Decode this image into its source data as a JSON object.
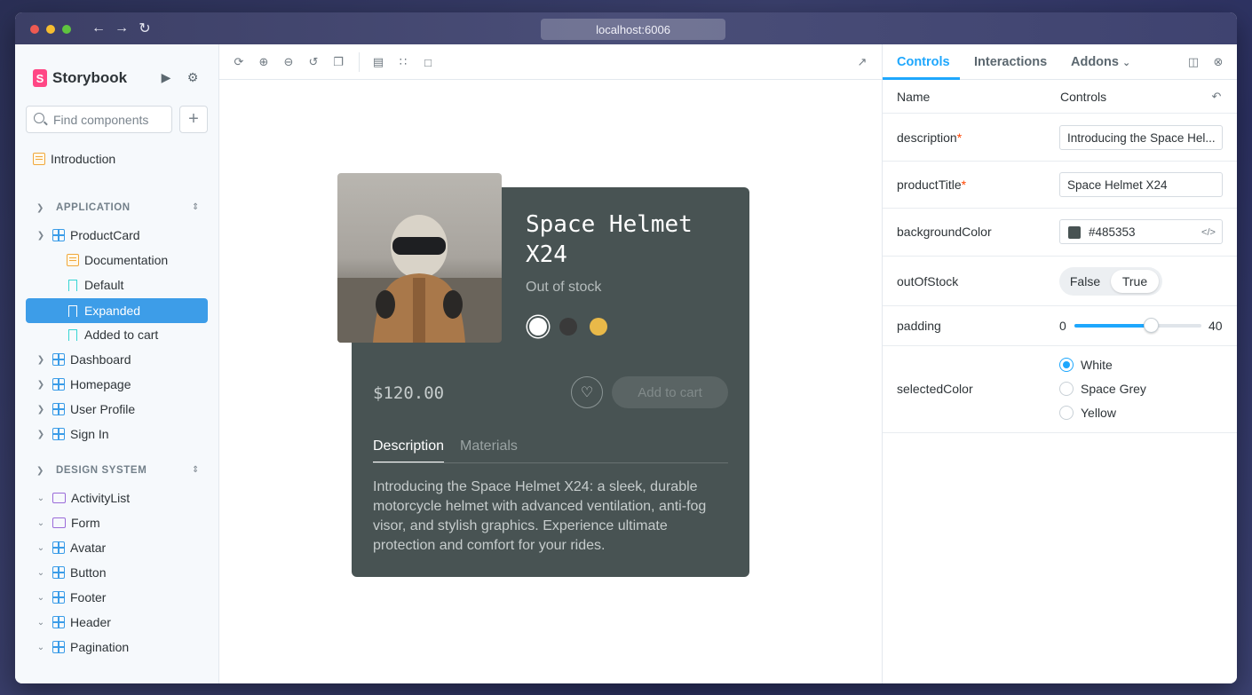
{
  "browser": {
    "url": "localhost:6006",
    "back_icon": "arrow-left-icon",
    "forward_icon": "arrow-right-icon",
    "reload_icon": "reload-icon"
  },
  "sidebar": {
    "brand": "Storybook",
    "search_placeholder": "Find components",
    "introduction": "Introduction",
    "sections": [
      {
        "label": "APPLICATION"
      },
      {
        "label": "DESIGN SYSTEM"
      }
    ],
    "app_items": [
      {
        "label": "ProductCard"
      },
      {
        "label": "Documentation"
      },
      {
        "label": "Default"
      },
      {
        "label": "Expanded"
      },
      {
        "label": "Added to cart"
      },
      {
        "label": "Dashboard"
      },
      {
        "label": "Homepage"
      },
      {
        "label": "User Profile"
      },
      {
        "label": "Sign In"
      }
    ],
    "ds_items": [
      {
        "label": "ActivityList"
      },
      {
        "label": "Form"
      },
      {
        "label": "Avatar"
      },
      {
        "label": "Button"
      },
      {
        "label": "Footer"
      },
      {
        "label": "Header"
      },
      {
        "label": "Pagination"
      }
    ],
    "selected": "Expanded"
  },
  "card": {
    "title": "Space Helmet X24",
    "status": "Out of stock",
    "price": "$120.00",
    "cart_label": "Add to cart",
    "tab_description": "Description",
    "tab_materials": "Materials",
    "description": "Introducing the Space Helmet X24: a sleek, durable motorcycle helmet with advanced ventilation, anti-fog visor, and stylish graphics. Experience ultimate protection and comfort for your rides.",
    "background_color": "#485353",
    "swatches": [
      "#ffffff",
      "#3a3a3a",
      "#e9b949"
    ]
  },
  "panel": {
    "tabs": [
      "Controls",
      "Interactions",
      "Addons"
    ],
    "col_name": "Name",
    "col_controls": "Controls",
    "rows": {
      "description": {
        "label": "description",
        "value": "Introducing the Space Hel..."
      },
      "productTitle": {
        "label": "productTitle",
        "value": "Space Helmet X24"
      },
      "backgroundColor": {
        "label": "backgroundColor",
        "value": "#485353"
      },
      "outOfStock": {
        "label": "outOfStock",
        "false_label": "False",
        "true_label": "True",
        "value": true
      },
      "padding": {
        "label": "padding",
        "min": "0",
        "max": "40",
        "value_fraction": 0.6
      },
      "selectedColor": {
        "label": "selectedColor",
        "options": [
          "White",
          "Space Grey",
          "Yellow"
        ],
        "selected": "White"
      }
    },
    "required_mark": "*"
  }
}
